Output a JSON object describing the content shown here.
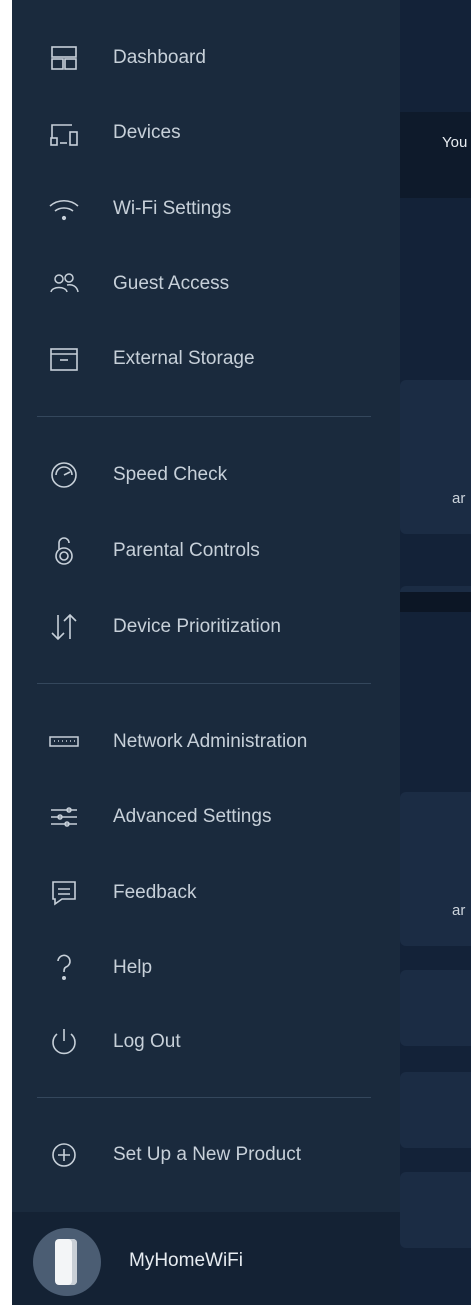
{
  "menu": {
    "items": [
      {
        "label": "Dashboard",
        "icon": "dashboard-icon"
      },
      {
        "label": "Devices",
        "icon": "devices-icon"
      },
      {
        "label": "Wi-Fi Settings",
        "icon": "wifi-icon"
      },
      {
        "label": "Guest Access",
        "icon": "guest-access-icon"
      },
      {
        "label": "External Storage",
        "icon": "storage-icon"
      },
      {
        "label": "Speed Check",
        "icon": "speedometer-icon"
      },
      {
        "label": "Parental Controls",
        "icon": "lock-icon"
      },
      {
        "label": "Device Prioritization",
        "icon": "priority-arrows-icon"
      },
      {
        "label": "Network Administration",
        "icon": "router-icon"
      },
      {
        "label": "Advanced Settings",
        "icon": "sliders-icon"
      },
      {
        "label": "Feedback",
        "icon": "chat-bubble-icon"
      },
      {
        "label": "Help",
        "icon": "question-icon"
      },
      {
        "label": "Log Out",
        "icon": "power-icon"
      },
      {
        "label": "Set Up a New Product",
        "icon": "plus-circle-icon"
      }
    ]
  },
  "account": {
    "network_name": "MyHomeWiFi",
    "icon": "node-avatar-icon"
  },
  "background": {
    "banner_text": "You",
    "card_text_1": "ar",
    "card_text_2": "ar"
  },
  "colors": {
    "drawer_bg": "#1a2a3d",
    "app_bg": "#132238",
    "text": "#c7d0d9"
  }
}
